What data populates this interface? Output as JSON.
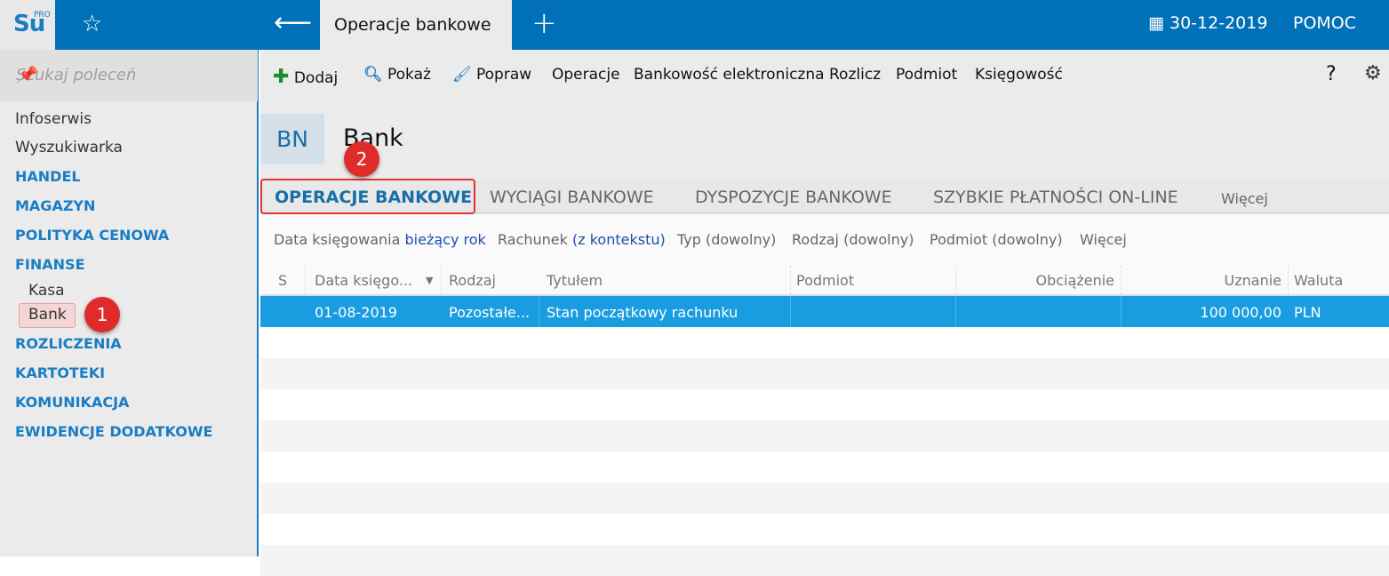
{
  "header": {
    "logo": "Su",
    "logo_sup": "PRO",
    "active_tab": "Operacje bankowe",
    "date": "30-12-2019",
    "help": "POMOC"
  },
  "sidebar": {
    "search_placeholder": "Szukaj poleceń",
    "items": [
      "Infoserwis",
      "Wyszukiwarka"
    ],
    "sections": [
      "HANDEL",
      "MAGAZYN",
      "POLITYKA CENOWA",
      "FINANSE"
    ],
    "finanse_sub": [
      "Kasa",
      "Bank"
    ],
    "sections2": [
      "ROZLICZENIA",
      "KARTOTEKI",
      "KOMUNIKACJA",
      "EWIDENCJE DODATKOWE"
    ]
  },
  "badges": [
    "1",
    "2"
  ],
  "toolbar": {
    "items": [
      "Dodaj",
      "Pokaż",
      "Popraw",
      "Operacje",
      "Bankowość elektroniczna",
      "Rozlicz",
      "Podmiot",
      "Księgowość"
    ],
    "help": "?"
  },
  "page": {
    "code": "BN",
    "title": "Bank"
  },
  "tabs": [
    "OPERACJE BANKOWE",
    "WYCIĄGI BANKOWE",
    "DYSPOZYCJE BANKOWE",
    "SZYBKIE PŁATNOŚCI ON-LINE",
    "Więcej"
  ],
  "filters": {
    "data_label": "Data księgowania",
    "data_value": "bieżący rok",
    "rach_label": "Rachunek",
    "rach_value": "(z kontekstu)",
    "typ": "Typ (dowolny)",
    "rodzaj": "Rodzaj (dowolny)",
    "podmiot": "Podmiot (dowolny)",
    "more": "Więcej"
  },
  "table": {
    "columns": [
      "S",
      "Data księgo...",
      "Rodzaj",
      "Tytułem",
      "Podmiot",
      "Obciążenie",
      "Uznanie",
      "Waluta"
    ],
    "rows": [
      {
        "s": "",
        "data": "01-08-2019",
        "rodzaj": "Pozostałe...",
        "tytul": "Stan początkowy rachunku",
        "podmiot": "",
        "obciazenie": "",
        "uznanie": "100 000,00",
        "waluta": "PLN"
      }
    ]
  }
}
